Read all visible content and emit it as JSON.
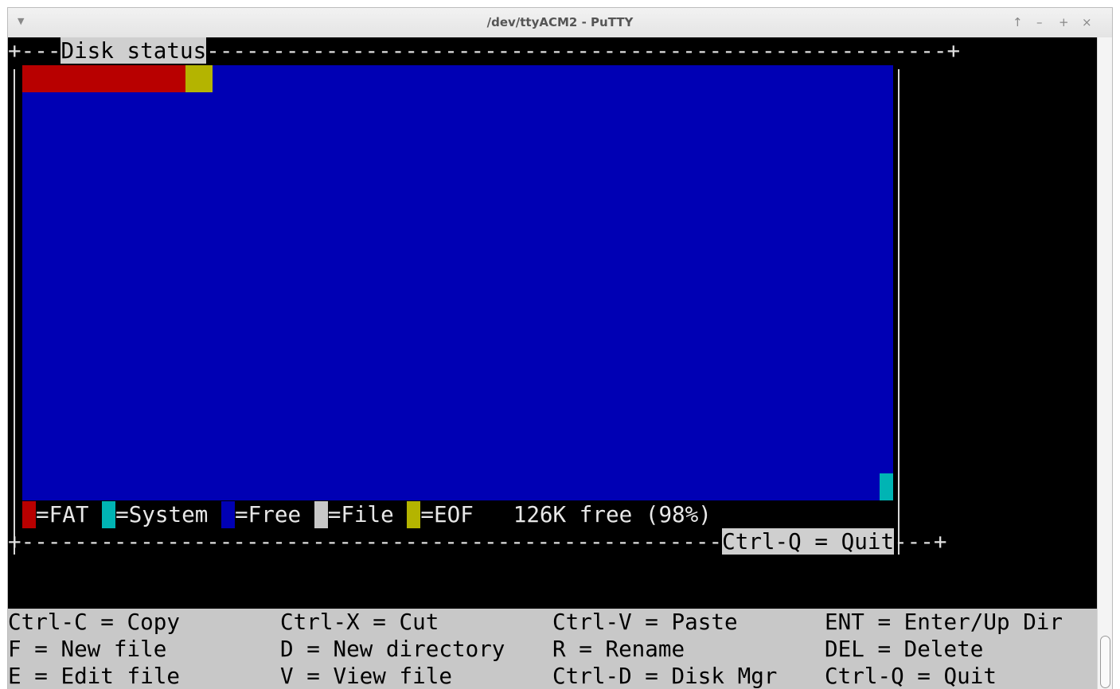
{
  "window": {
    "title": "/dev/ttyACM2 - PuTTY",
    "menu_glyph": "▼",
    "controls": [
      "↑",
      "–",
      "+",
      "×"
    ]
  },
  "disk": {
    "panel_title": "Disk status",
    "quit_hint": "Ctrl-Q = Quit",
    "legend": [
      {
        "label": "=FAT",
        "color": "#b80000"
      },
      {
        "label": "=System",
        "color": "#00b4b4"
      },
      {
        "label": "=Free",
        "color": "#0000b4"
      },
      {
        "label": "=File",
        "color": "#c8c8c8"
      },
      {
        "label": "=EOF",
        "color": "#b4b400"
      }
    ],
    "free_text": "126K free (98%)"
  },
  "shortcuts": {
    "rows": [
      [
        "Ctrl-C = Copy",
        "Ctrl-X = Cut",
        "Ctrl-V = Paste",
        "ENT = Enter/Up Dir"
      ],
      [
        "F = New file",
        "D = New directory",
        "R = Rename",
        "DEL = Delete"
      ],
      [
        "E = Edit file",
        "V = View file",
        "Ctrl-D = Disk Mgr",
        "Ctrl-Q = Quit"
      ]
    ]
  }
}
